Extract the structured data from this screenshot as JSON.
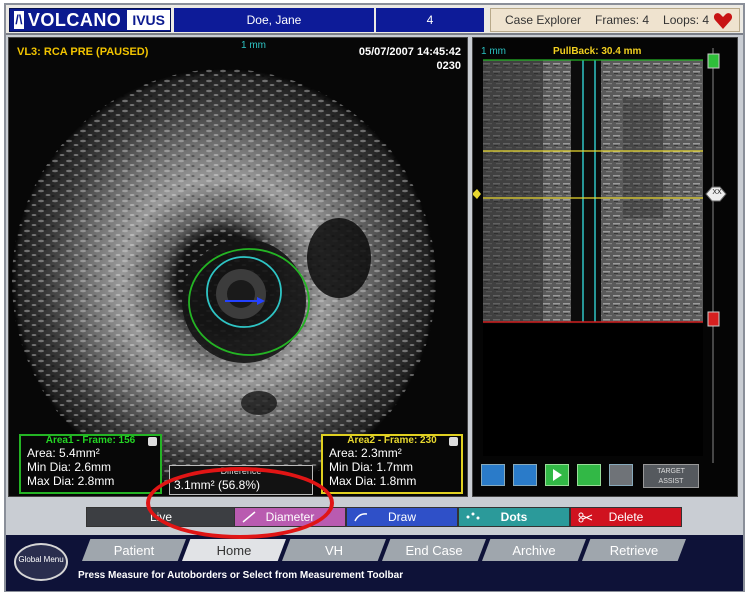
{
  "header": {
    "brand": "VOLCANO",
    "product": "IVUS",
    "patient_name": "Doe, Jane",
    "patient_number": "4",
    "case_explorer": "Case Explorer",
    "frames": "Frames: 4",
    "loops": "Loops: 4"
  },
  "main_view": {
    "title": "VL3: RCA PRE (PAUSED)",
    "date_time": "05/07/2007 14:45:42",
    "frame_number": "0230",
    "scale_label": "1 mm"
  },
  "measurement_1": {
    "title": "Area1 - Frame: 156",
    "area": "Area: 5.4mm²",
    "min_dia": "Min Dia: 2.6mm",
    "max_dia": "Max Dia: 2.8mm"
  },
  "measurement_2": {
    "title": "Area2 - Frame: 230",
    "area": "Area: 2.3mm²",
    "min_dia": "Min Dia: 1.7mm",
    "max_dia": "Max Dia: 1.8mm"
  },
  "difference": {
    "title": "Difference",
    "value": "3.1mm² (56.8%)"
  },
  "long_view": {
    "scale_label": "1 mm",
    "pullback": "PullBack: 30.4 mm",
    "marker_label": "XX",
    "assist_label": "TARGET ASSIST"
  },
  "actions": {
    "live": "Live",
    "diameter": "Diameter",
    "draw": "Draw",
    "dots": "Dots",
    "delete": "Delete"
  },
  "nav": {
    "global_menu": "Global Menu",
    "tabs": [
      "Patient",
      "Home",
      "VH",
      "End Case",
      "Archive",
      "Retrieve"
    ],
    "hint": "Press Measure for Autoborders or Select from Measurement Toolbar"
  },
  "colors": {
    "brand_blue": "#0b1a8f",
    "lumen_border": "#2ec4c4",
    "vessel_border": "#24b424",
    "frame_line": "#f2d020",
    "highlight": "#e01515"
  }
}
